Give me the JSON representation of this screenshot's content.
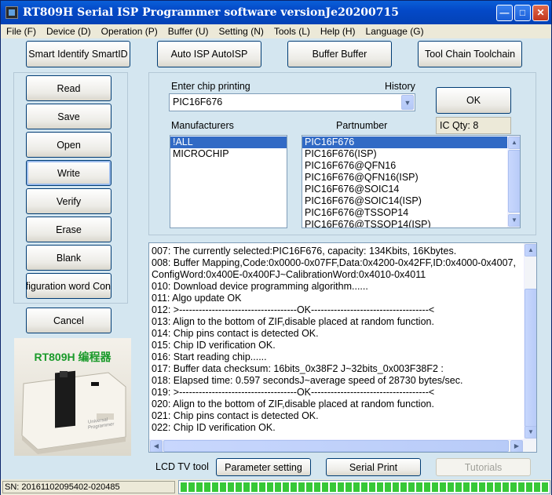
{
  "window": {
    "title": "RT809H Serial ISP Programmer software versionJe20200715"
  },
  "menu": [
    "File (F)",
    "Device (D)",
    "Operation (P)",
    "Buffer (U)",
    "Setting (N)",
    "Tools (L)",
    "Help (H)",
    "Language (G)"
  ],
  "toolbar": {
    "smart_identify": "Smart Identify SmartID",
    "auto_isp": "Auto ISP AutoISP",
    "buffer": "Buffer Buffer",
    "tool_chain": "Tool Chain Toolchain"
  },
  "side_buttons": [
    "Read",
    "Save",
    "Open",
    "Write",
    "Verify",
    "Erase",
    "Blank",
    "Configuration word Con"
  ],
  "cancel_label": "Cancel",
  "chip": {
    "enter_label": "Enter chip printing",
    "history_label": "History",
    "value": "PIC16F676",
    "ok_label": "OK",
    "ic_qty": "IC Qty: 8"
  },
  "manufacturers": {
    "label": "Manufacturers",
    "items": [
      "!ALL",
      "MICROCHIP"
    ],
    "selected": 0
  },
  "partnumber": {
    "label": "Partnumber",
    "items": [
      "PIC16F676",
      "PIC16F676(ISP)",
      "PIC16F676@QFN16",
      "PIC16F676@QFN16(ISP)",
      "PIC16F676@SOIC14",
      "PIC16F676@SOIC14(ISP)",
      "PIC16F676@TSSOP14",
      "PIC16F676@TSSOP14(ISP)"
    ],
    "selected": 0
  },
  "log": [
    "007:  The currently selected:PIC16F676, capacity: 134Kbits, 16Kbytes.",
    "008:  Buffer Mapping,Code:0x0000-0x07FF,Data:0x4200-0x42FF,ID:0x4000-0x4007,",
    "ConfigWord:0x400E-0x400FJ~CalibrationWord:0x4010-0x4011",
    "010:  Download device programming algorithm......",
    "011:  Algo update OK",
    "012:  >------------------------------------OK------------------------------------<",
    "013:  Align to the bottom of ZIF,disable placed at random function.",
    "014:  Chip pins contact is detected OK.",
    "015:  Chip ID verification OK.",
    "016:  Start reading chip......",
    "017:  Buffer data checksum: 16bits_0x38F2 J~32bits_0x003F38F2 :",
    "018:  Elapsed time: 0.597 secondsJ~average speed of 28730 bytes/sec.",
    "019:  >------------------------------------OK------------------------------------<",
    "020:  Align to the bottom of ZIF,disable placed at random function.",
    "021:  Chip pins contact is detected OK.",
    "022:  Chip ID verification OK."
  ],
  "bottom": {
    "lcd_label": "LCD TV tool",
    "parameter_setting": "Parameter setting",
    "serial_print": "Serial Print",
    "tutorials": "Tutorials"
  },
  "logo": {
    "title": "RT809H 编程器",
    "device_text": "Universal Programmer"
  },
  "status": {
    "sn": "SN: 20161102095402-020485",
    "progress": 1.0
  },
  "colors": {
    "titlebar": "#0449c8",
    "selection": "#316ac5",
    "progress": "#37c837",
    "logo_title": "#1a9a2a"
  }
}
